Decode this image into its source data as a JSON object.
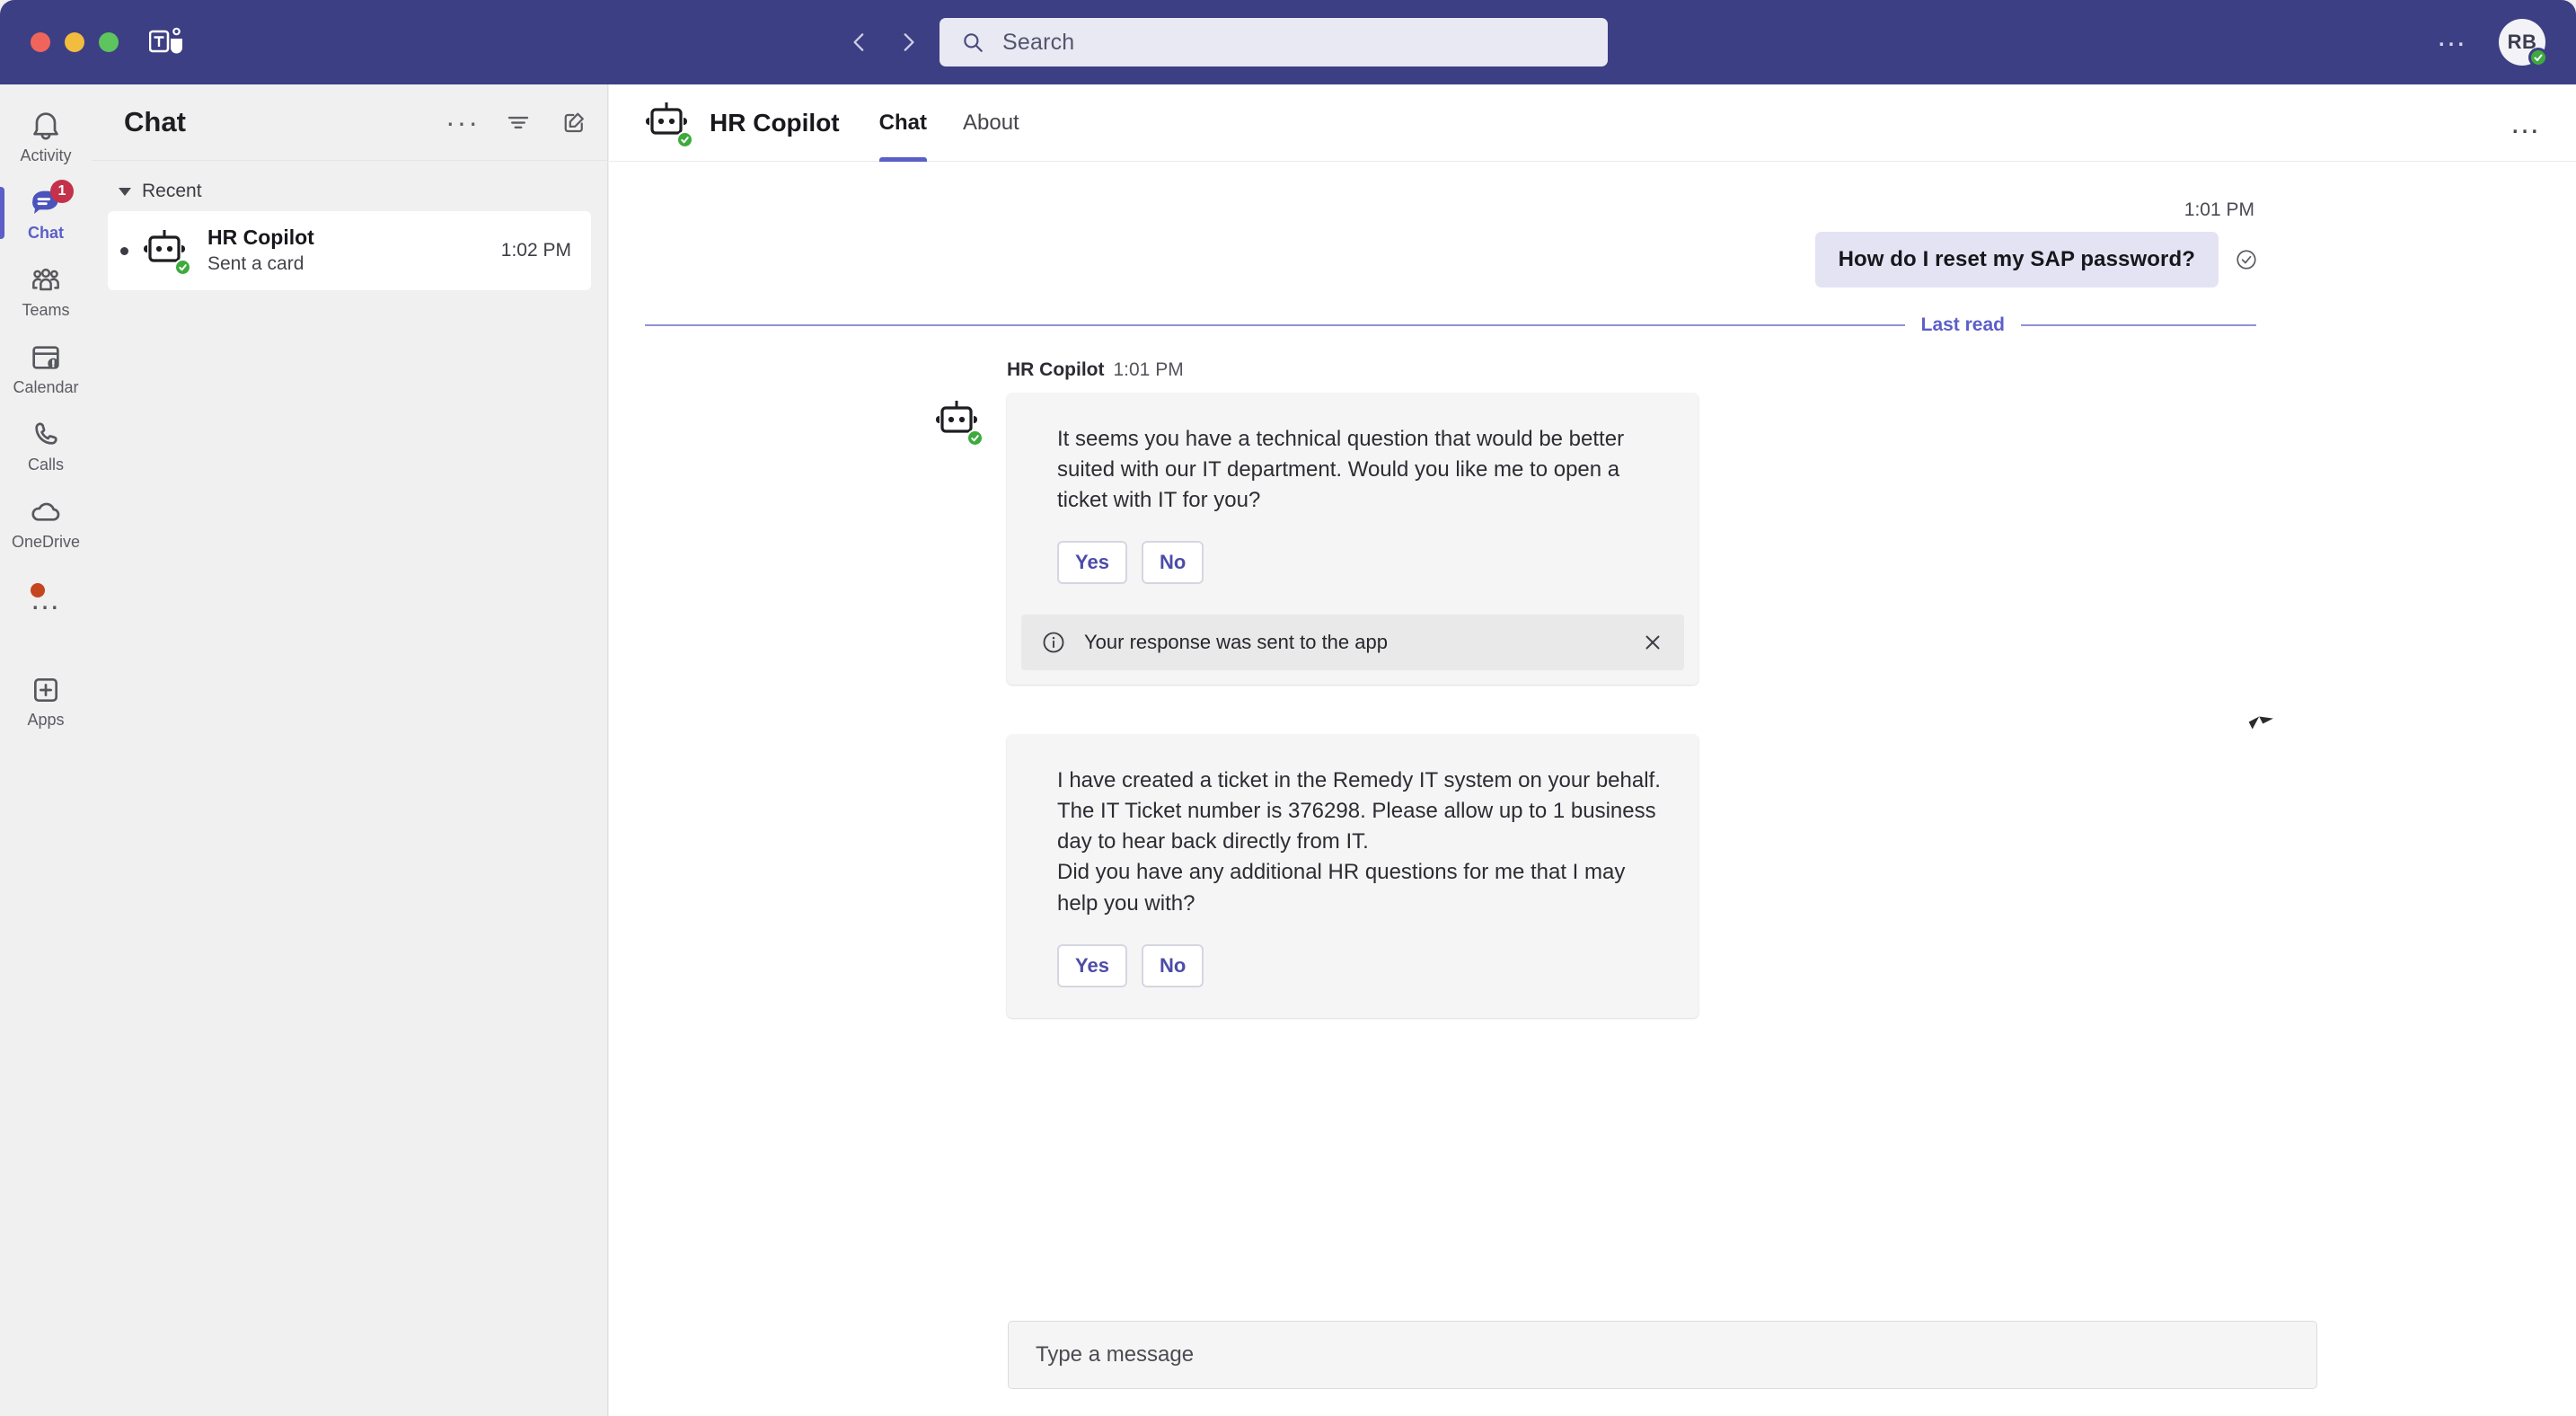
{
  "window": {
    "traffic_lights": [
      "close",
      "minimize",
      "maximize"
    ],
    "app_logo": "microsoft-teams-logo"
  },
  "topbar": {
    "back_label": "Back",
    "forward_label": "Forward",
    "search": {
      "placeholder": "Search",
      "value": "",
      "icon": "search-icon"
    },
    "settings_ellipsis": "…",
    "avatar_initials": "RB",
    "avatar_presence": "available"
  },
  "rail": {
    "items": [
      {
        "label": "Activity",
        "icon": "bell-icon",
        "active": false,
        "badge": ""
      },
      {
        "label": "Chat",
        "icon": "chat-bubble-icon",
        "active": true,
        "badge": "1"
      },
      {
        "label": "Teams",
        "icon": "people-icon",
        "active": false,
        "badge": ""
      },
      {
        "label": "Calendar",
        "icon": "calendar-icon",
        "active": false,
        "badge": ""
      },
      {
        "label": "Calls",
        "icon": "phone-icon",
        "active": false,
        "badge": ""
      },
      {
        "label": "OneDrive",
        "icon": "cloud-icon",
        "active": false,
        "badge": ""
      }
    ],
    "more_label": "…",
    "apps": {
      "label": "Apps",
      "icon": "plus-square-icon"
    }
  },
  "chat_panel": {
    "title": "Chat",
    "actions": [
      {
        "name": "more-options",
        "icon": "ellipsis-icon"
      },
      {
        "name": "filter",
        "icon": "filter-icon"
      },
      {
        "name": "new-chat",
        "icon": "compose-icon"
      }
    ],
    "section": {
      "label": "Recent",
      "expanded": true
    },
    "items": [
      {
        "name": "HR Copilot",
        "preview": "Sent a card",
        "time": "1:02 PM",
        "avatar": "robot-icon",
        "presence": "available",
        "unread": true,
        "selected": true
      }
    ]
  },
  "conversation": {
    "header": {
      "title": "HR Copilot",
      "avatar": "robot-icon",
      "presence": "available",
      "tabs": [
        {
          "label": "Chat",
          "active": true
        },
        {
          "label": "About",
          "active": false
        }
      ],
      "more": "…"
    },
    "outgoing": {
      "time": "1:01 PM",
      "text": "How do I reset my SAP password?",
      "status_icon": "check-circle-icon"
    },
    "divider": {
      "label": "Last read"
    },
    "bot": {
      "name": "HR Copilot",
      "time": "1:01 PM",
      "avatar": "robot-icon",
      "presence": "available"
    },
    "cards": [
      {
        "paragraphs": [
          "It seems you have a technical question that would be better suited with our IT department. Would you like me to open a ticket with IT for you?"
        ],
        "buttons": [
          "Yes",
          "No"
        ],
        "notice": {
          "text": "Your response was sent to the app",
          "info_icon": "info-circle-icon",
          "close_icon": "close-icon"
        }
      },
      {
        "paragraphs": [
          "I have created a ticket in the Remedy IT system on your behalf. The IT Ticket number is 376298. Please allow up to 1 business day to hear back directly from IT.",
          "Did you have any additional HR questions for me that I may help you with?"
        ],
        "buttons": [
          "Yes",
          "No"
        ],
        "notice": null
      }
    ],
    "compose": {
      "placeholder": "Type a message",
      "value": ""
    }
  },
  "colors": {
    "titlebar": "#3d3f84",
    "accent": "#5b5fc7",
    "badge": "#c4314b",
    "presence_available": "#3eaa3e",
    "outgoing_bubble": "#e3e3f3",
    "card_bg": "#f5f5f5"
  }
}
